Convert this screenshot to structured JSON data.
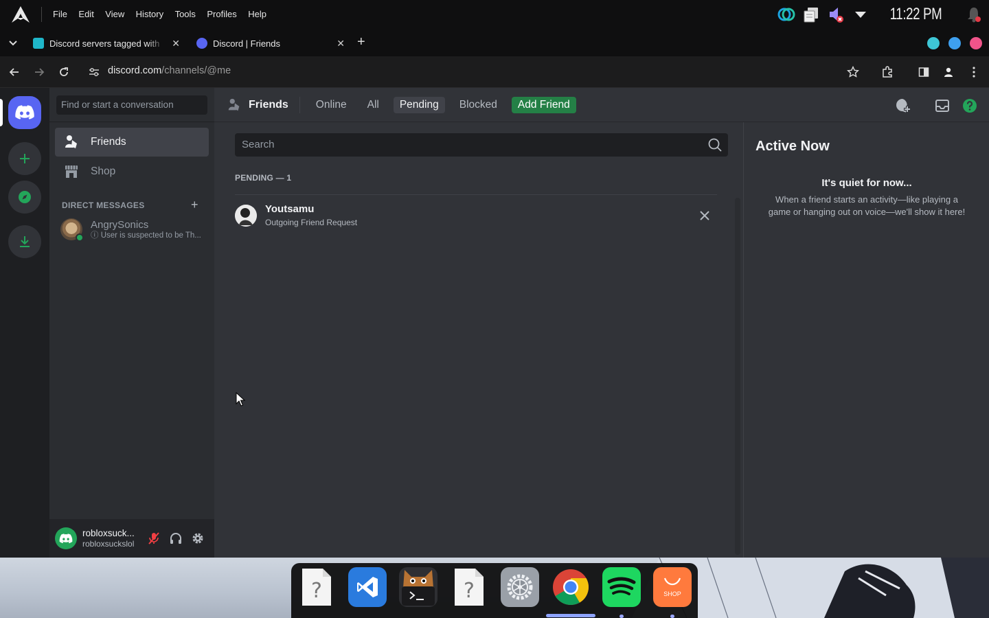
{
  "os": {
    "menu": [
      "File",
      "Edit",
      "View",
      "History",
      "Tools",
      "Profiles",
      "Help"
    ],
    "clock": "11:22 PM",
    "tray_icons": [
      "sync-icon",
      "clipboard-icon",
      "volume-muted-icon",
      "dropdown-icon",
      "notification-bell-icon"
    ]
  },
  "browser": {
    "tabs": [
      {
        "title": "Discord servers tagged with",
        "active": false
      },
      {
        "title": "Discord | Friends",
        "active": true
      }
    ],
    "new_tab": "+",
    "url_host": "discord.com",
    "url_path": "/channels/@me"
  },
  "discord": {
    "dm_search_placeholder": "Find or start a conversation",
    "nav": [
      {
        "label": "Friends",
        "icon": "friends-icon",
        "active": true
      },
      {
        "label": "Shop",
        "icon": "shop-icon",
        "active": false
      }
    ],
    "dm_header": "DIRECT MESSAGES",
    "dm_add": "+",
    "dms": [
      {
        "name": "AngrySonics",
        "status": "User is suspected to be Th...",
        "online": true
      }
    ],
    "user": {
      "display": "robloxsuck...",
      "handle": "robloxsuckslol"
    },
    "topbar": {
      "title": "Friends",
      "tabs": [
        "Online",
        "All",
        "Pending",
        "Blocked"
      ],
      "selected_tab": "Pending",
      "add_friend": "Add Friend"
    },
    "search_placeholder": "Search",
    "pending_header": "PENDING — 1",
    "pending": [
      {
        "name": "Youtsamu",
        "subtitle": "Outgoing Friend Request"
      }
    ],
    "active_now": {
      "title": "Active Now",
      "quiet": "It's quiet for now...",
      "description": "When a friend starts an activity—like playing a game or hanging out on voice—we'll show it here!"
    },
    "colors": {
      "blurple": "#5865f2",
      "green": "#248046",
      "bg": "#313338",
      "sidebar": "#2b2d31",
      "servers": "#1e1f22"
    }
  },
  "dock": {
    "apps": [
      "unknown-file-icon",
      "vscode-icon",
      "terminal-icon",
      "unknown-file-icon",
      "settings-icon",
      "chrome-icon",
      "spotify-icon",
      "shop-icon"
    ],
    "shop_label": "SHOP"
  }
}
